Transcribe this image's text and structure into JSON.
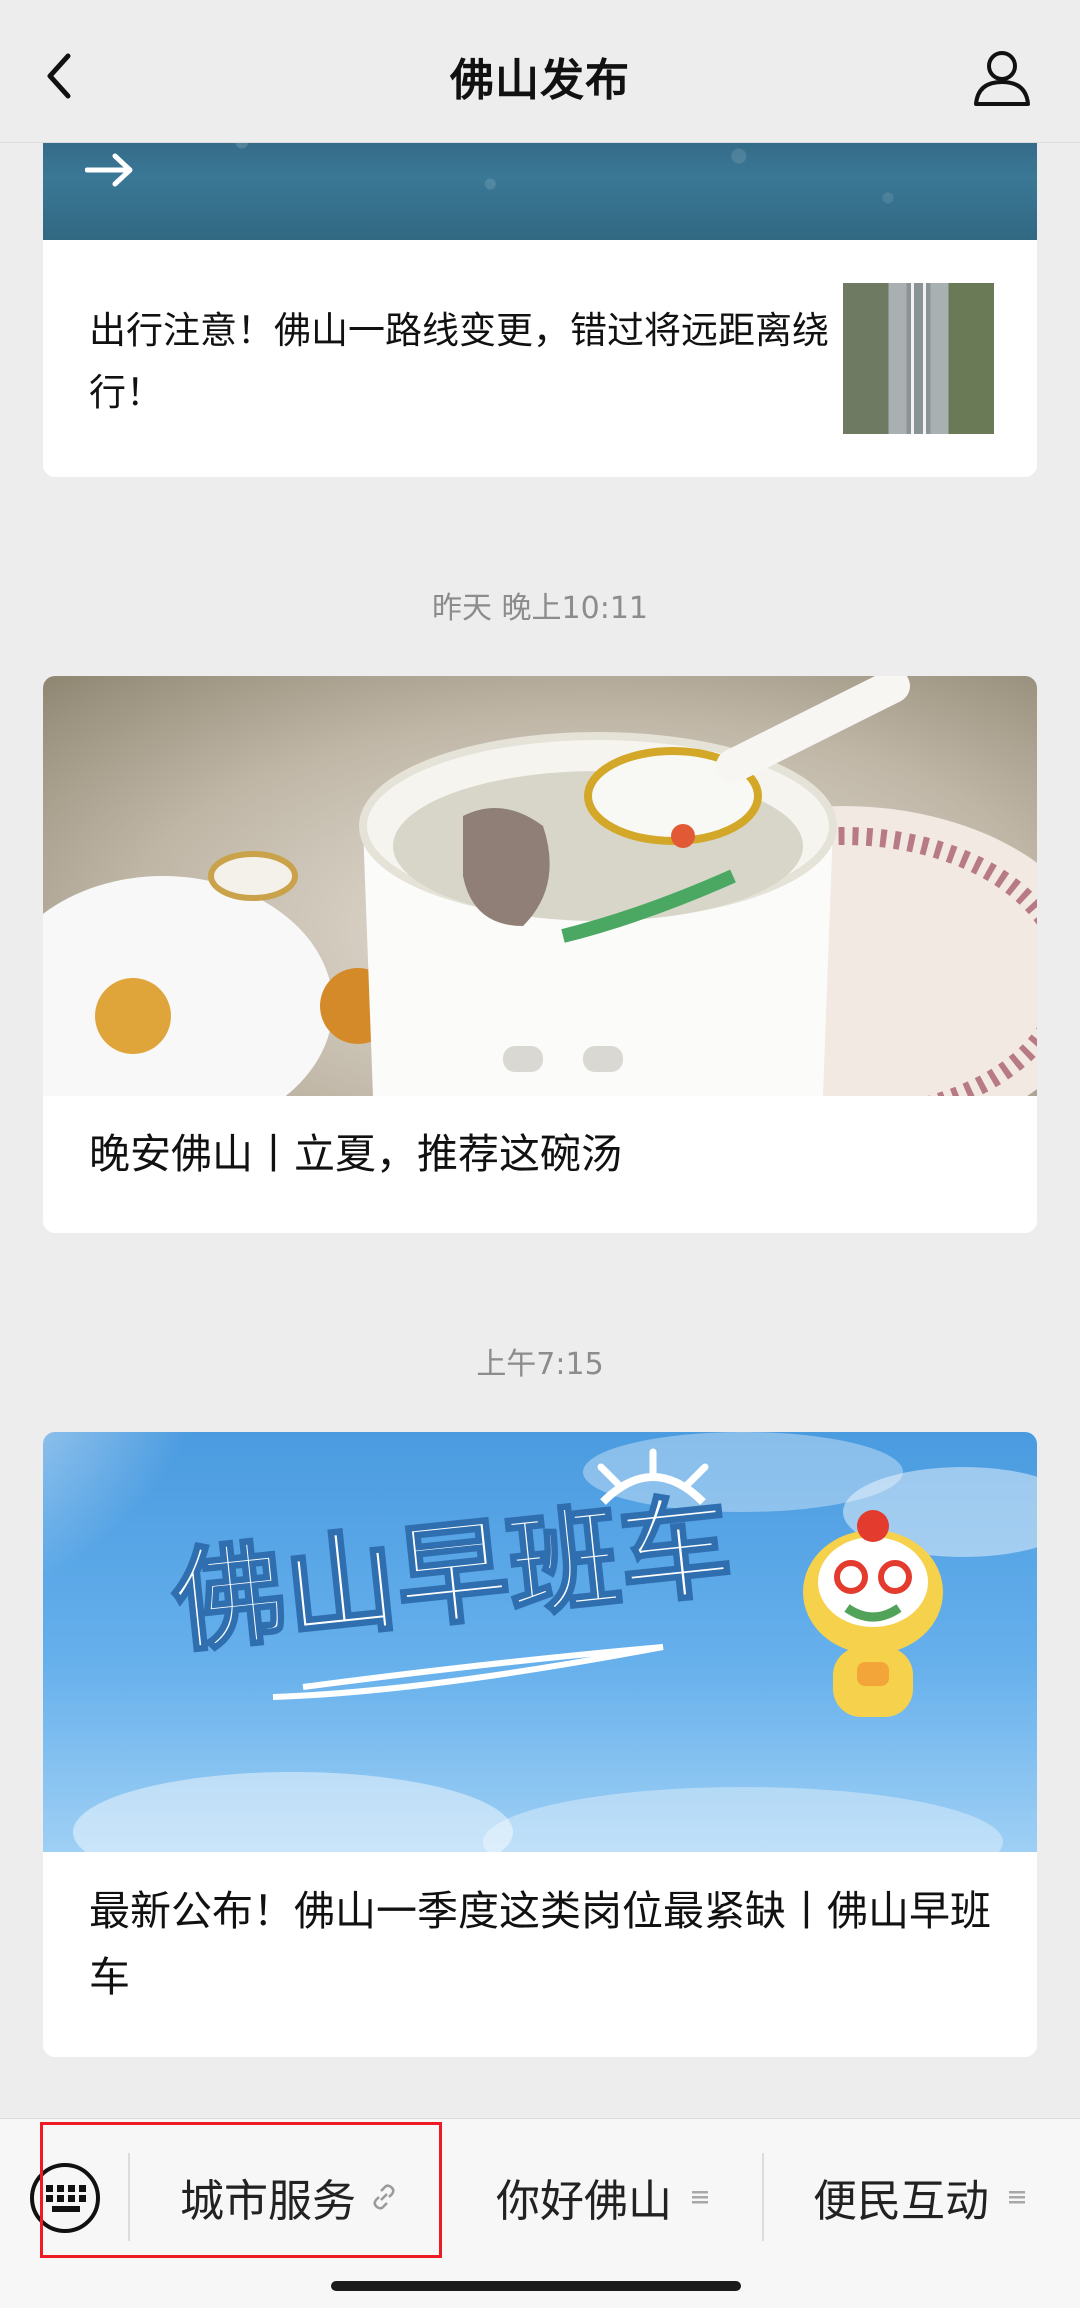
{
  "header": {
    "title": "佛山发布",
    "back_icon": "chevron-left-icon",
    "profile_icon": "person-icon"
  },
  "feed": {
    "articles": [
      {
        "title": "出行注意！佛山一路线变更，错过将远距离绕行！"
      },
      {
        "timestamp": "昨天 晚上10:11",
        "title": "晚安佛山丨立夏，推荐这碗汤"
      },
      {
        "timestamp": "上午7:15",
        "title": "最新公布！佛山一季度这类岗位最紧缺丨佛山早班车",
        "cover_text": "佛山早班车"
      }
    ]
  },
  "menu": {
    "keyboard_icon": "keyboard-icon",
    "items": [
      {
        "label": "城市服务",
        "icon": "link-icon"
      },
      {
        "label": "你好佛山",
        "icon": "list-icon"
      },
      {
        "label": "便民互动",
        "icon": "list-icon"
      }
    ]
  },
  "colors": {
    "highlight": "#ee1b24",
    "background": "#ededed"
  }
}
